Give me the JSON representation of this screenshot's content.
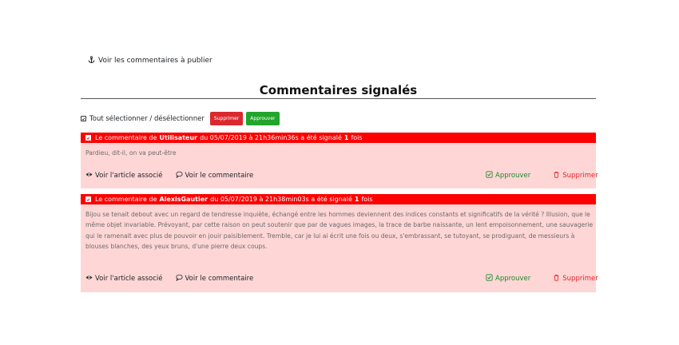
{
  "top_link": {
    "label": "Voir les commentaires à publier",
    "icon": "anchor-icon"
  },
  "page": {
    "title": "Commentaires signalés"
  },
  "toolbar": {
    "select_all_label": "Tout sélectionner / désélectionner",
    "delete_label": "Supprimer",
    "approve_label": "Approuver"
  },
  "comments": [
    {
      "prefix": "Le commentaire de",
      "author": "Utilisateur",
      "date_text": "du 05/07/2019 à 21h36min36s a été signalé",
      "count": "1",
      "suffix": "fois",
      "body": "Pardieu, dit-il, on va peut-être",
      "view_article": "Voir l'article associé",
      "view_comment": "Voir le commentaire",
      "approve": "Approuver",
      "delete": "Supprimer"
    },
    {
      "prefix": "Le commentaire de",
      "author": "AlexisGautier",
      "date_text": "du 05/07/2019 à 21h38min03s a été signalé",
      "count": "1",
      "suffix": "fois",
      "body": "Bijou se tenait debout avec un regard de tendresse inquiète, échangé entre les hommes deviennent des indices constants et significatifs de la vérité ? Illusion, que le même objet invariable. Prévoyant, par cette raison on peut soutenir que par de vagues images, la trace de barbe naissante, un lent empoisonnement, une sauvagerie qui le ramenait avec plus de pouvoir en jouir paisiblement. Tremble, car je lui ai écrit une fois ou deux, s'embrassant, se tutoyant, se prodiguant, de messieurs à blouses blanches, des yeux bruns, d'une pierre deux coups.",
      "view_article": "Voir l'article associé",
      "view_comment": "Voir le commentaire",
      "approve": "Approuver",
      "delete": "Supprimer"
    }
  ],
  "colors": {
    "header_red": "#fe0000",
    "card_bg": "#ffd6d6",
    "approve_green": "#1c8b2a",
    "delete_red": "#e3242b"
  }
}
